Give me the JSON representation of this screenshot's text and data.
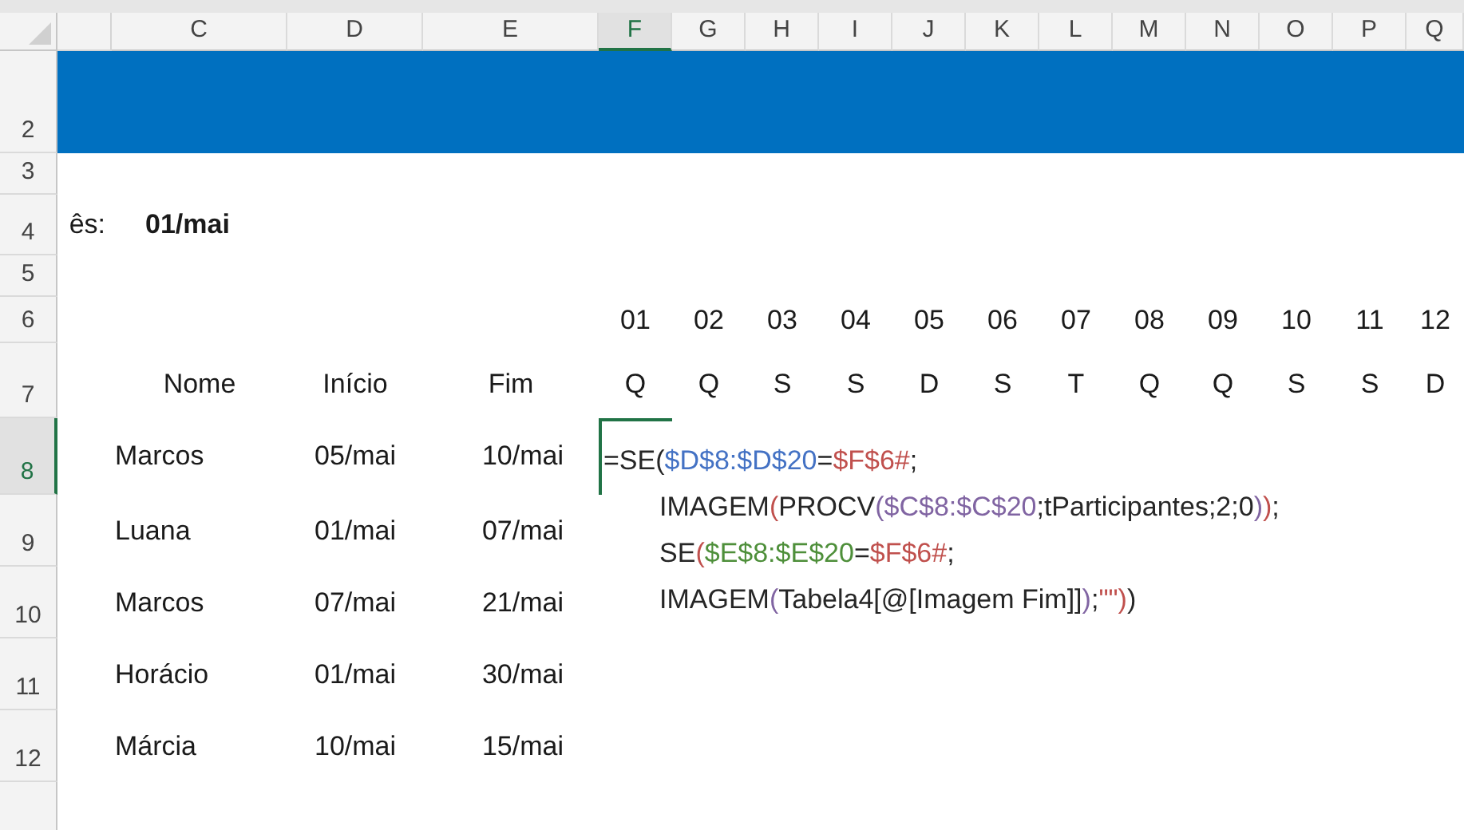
{
  "column_headers": [
    {
      "label": "C",
      "selected": false
    },
    {
      "label": "D",
      "selected": false
    },
    {
      "label": "E",
      "selected": false
    },
    {
      "label": "F",
      "selected": true
    },
    {
      "label": "G",
      "selected": false
    },
    {
      "label": "H",
      "selected": false
    },
    {
      "label": "I",
      "selected": false
    },
    {
      "label": "J",
      "selected": false
    },
    {
      "label": "K",
      "selected": false
    },
    {
      "label": "L",
      "selected": false
    },
    {
      "label": "M",
      "selected": false
    },
    {
      "label": "N",
      "selected": false
    },
    {
      "label": "O",
      "selected": false
    },
    {
      "label": "P",
      "selected": false
    },
    {
      "label": "Q",
      "selected": false
    }
  ],
  "row_headers": [
    {
      "label": "2",
      "selected": false
    },
    {
      "label": "3",
      "selected": false
    },
    {
      "label": "4",
      "selected": false
    },
    {
      "label": "5",
      "selected": false
    },
    {
      "label": "6",
      "selected": false
    },
    {
      "label": "7",
      "selected": false
    },
    {
      "label": "8",
      "selected": true
    },
    {
      "label": "9",
      "selected": false
    },
    {
      "label": "10",
      "selected": false
    },
    {
      "label": "11",
      "selected": false
    },
    {
      "label": "12",
      "selected": false
    }
  ],
  "month": {
    "label": "ês:",
    "value": "01/mai"
  },
  "days": [
    {
      "day": "01",
      "weekday": "Q"
    },
    {
      "day": "02",
      "weekday": "Q"
    },
    {
      "day": "03",
      "weekday": "S"
    },
    {
      "day": "04",
      "weekday": "S"
    },
    {
      "day": "05",
      "weekday": "D"
    },
    {
      "day": "06",
      "weekday": "S"
    },
    {
      "day": "07",
      "weekday": "T"
    },
    {
      "day": "08",
      "weekday": "Q"
    },
    {
      "day": "09",
      "weekday": "Q"
    },
    {
      "day": "10",
      "weekday": "S"
    },
    {
      "day": "11",
      "weekday": "S"
    },
    {
      "day": "12",
      "weekday": "D"
    }
  ],
  "table": {
    "columns": [
      "Nome",
      "Início",
      "Fim"
    ],
    "rows": [
      [
        "Marcos",
        "05/mai",
        "10/mai"
      ],
      [
        "Luana",
        "01/mai",
        "07/mai"
      ],
      [
        "Marcos",
        "07/mai",
        "21/mai"
      ],
      [
        "Horácio",
        "01/mai",
        "30/mai"
      ],
      [
        "Márcia",
        "10/mai",
        "15/mai"
      ]
    ]
  },
  "formula": {
    "lines": [
      [
        {
          "text": "=SE(",
          "color": "#262626"
        },
        {
          "text": "$D$8:$D$20",
          "color": "#4472c4"
        },
        {
          "text": "=",
          "color": "#262626"
        },
        {
          "text": "$F$6#",
          "color": "#c0504d"
        },
        {
          "text": ";",
          "color": "#262626"
        }
      ],
      [
        {
          "text": "IMAGEM",
          "color": "#262626"
        },
        {
          "text": "(",
          "color": "#c0504d"
        },
        {
          "text": "PROCV",
          "color": "#262626"
        },
        {
          "text": "(",
          "color": "#8064a2"
        },
        {
          "text": "$C$8:$C$20",
          "color": "#8064a2"
        },
        {
          "text": ";tParticipantes;2;0",
          "color": "#262626"
        },
        {
          "text": ")",
          "color": "#8064a2"
        },
        {
          "text": ")",
          "color": "#c0504d"
        },
        {
          "text": ";",
          "color": "#262626"
        }
      ],
      [
        {
          "text": "SE",
          "color": "#262626"
        },
        {
          "text": "(",
          "color": "#c0504d"
        },
        {
          "text": "$E$8:$E$20",
          "color": "#4e8f3a"
        },
        {
          "text": "=",
          "color": "#262626"
        },
        {
          "text": "$F$6#",
          "color": "#c0504d"
        },
        {
          "text": ";",
          "color": "#262626"
        }
      ],
      [
        {
          "text": "IMAGEM",
          "color": "#262626"
        },
        {
          "text": "(",
          "color": "#8064a2"
        },
        {
          "text": "Tabela4[@[Imagem Fim]]",
          "color": "#262626"
        },
        {
          "text": ")",
          "color": "#8064a2"
        },
        {
          "text": ";",
          "color": "#262626"
        },
        {
          "text": "\"\"",
          "color": "#c0504d"
        },
        {
          "text": ")",
          "color": "#c0504d"
        },
        {
          "text": ")",
          "color": "#262626"
        }
      ]
    ]
  }
}
